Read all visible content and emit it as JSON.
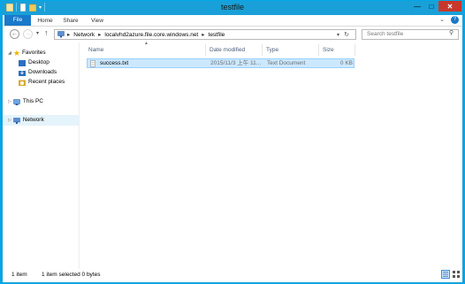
{
  "window": {
    "title": "testfile"
  },
  "ribbon": {
    "tabs": [
      "File",
      "Home",
      "Share",
      "View"
    ]
  },
  "address": {
    "segments": [
      "Network",
      "localvhd2azure.file.core.windows.net",
      "testfile"
    ],
    "search_placeholder": "Search testfile"
  },
  "sidebar": {
    "favorites": "Favorites",
    "items": [
      "Desktop",
      "Downloads",
      "Recent places"
    ],
    "this_pc": "This PC",
    "network": "Network"
  },
  "columns": [
    "Name",
    "Date modified",
    "Type",
    "Size"
  ],
  "files": [
    {
      "name": "success.txt",
      "date": "2015/11/3 上午 11...",
      "type": "Text Document",
      "size": "0 KB"
    }
  ],
  "status": {
    "count": "1 item",
    "selected": "1 item selected  0 bytes"
  },
  "colors": {
    "title_bar": "#19a0d8",
    "file_tab": "#1979ca",
    "selection": "#cce8ff",
    "close": "#c7382b"
  }
}
